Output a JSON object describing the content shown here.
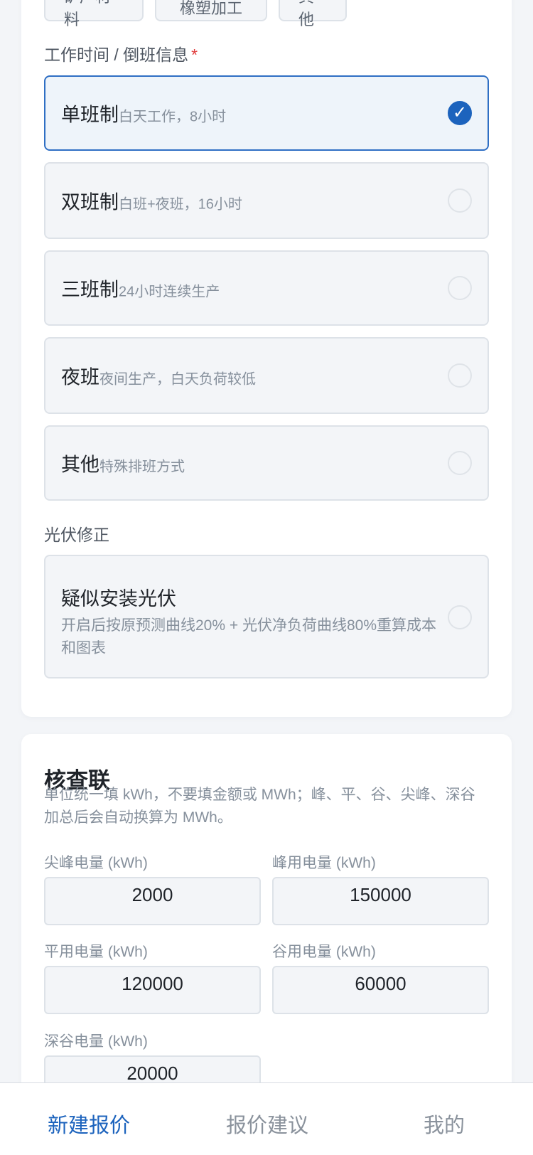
{
  "industry_chips": [
    "矿产材料",
    "橡塑加工",
    "其他"
  ],
  "shift_section": {
    "label": "工作时间 / 倒班信息",
    "required_mark": "*",
    "options": [
      {
        "title": "单班制",
        "desc": "白天工作，8小时",
        "selected": true
      },
      {
        "title": "双班制",
        "desc": "白班+夜班，16小时",
        "selected": false
      },
      {
        "title": "三班制",
        "desc": "24小时连续生产",
        "selected": false
      },
      {
        "title": "夜班",
        "desc": "夜间生产，白天负荷较低",
        "selected": false
      },
      {
        "title": "其他",
        "desc": "特殊排班方式",
        "selected": false
      }
    ],
    "check_mark": "✓"
  },
  "pv_section": {
    "label": "光伏修正",
    "option_title": "疑似安装光伏",
    "option_desc": "开启后按原预测曲线20% + 光伏净负荷曲线80%重算成本和图表"
  },
  "verification": {
    "title": "核查联",
    "note": "单位统一填 kWh，不要填金额或 MWh；峰、平、谷、尖峰、深谷加总后会自动换算为 MWh。",
    "fields": [
      {
        "label": "尖峰电量 (kWh)",
        "value": "2000"
      },
      {
        "label": "峰用电量 (kWh)",
        "value": "150000"
      },
      {
        "label": "平用电量 (kWh)",
        "value": "120000"
      },
      {
        "label": "谷用电量 (kWh)",
        "value": "60000"
      },
      {
        "label": "深谷电量 (kWh)",
        "value": "20000"
      }
    ]
  },
  "bottom_nav": {
    "items": [
      "新建报价",
      "报价建议",
      "我的"
    ],
    "active_index": 0
  },
  "colors": {
    "accent": "#1c63bd",
    "required": "#e03a3a",
    "selected_bg": "#eef4fa"
  }
}
